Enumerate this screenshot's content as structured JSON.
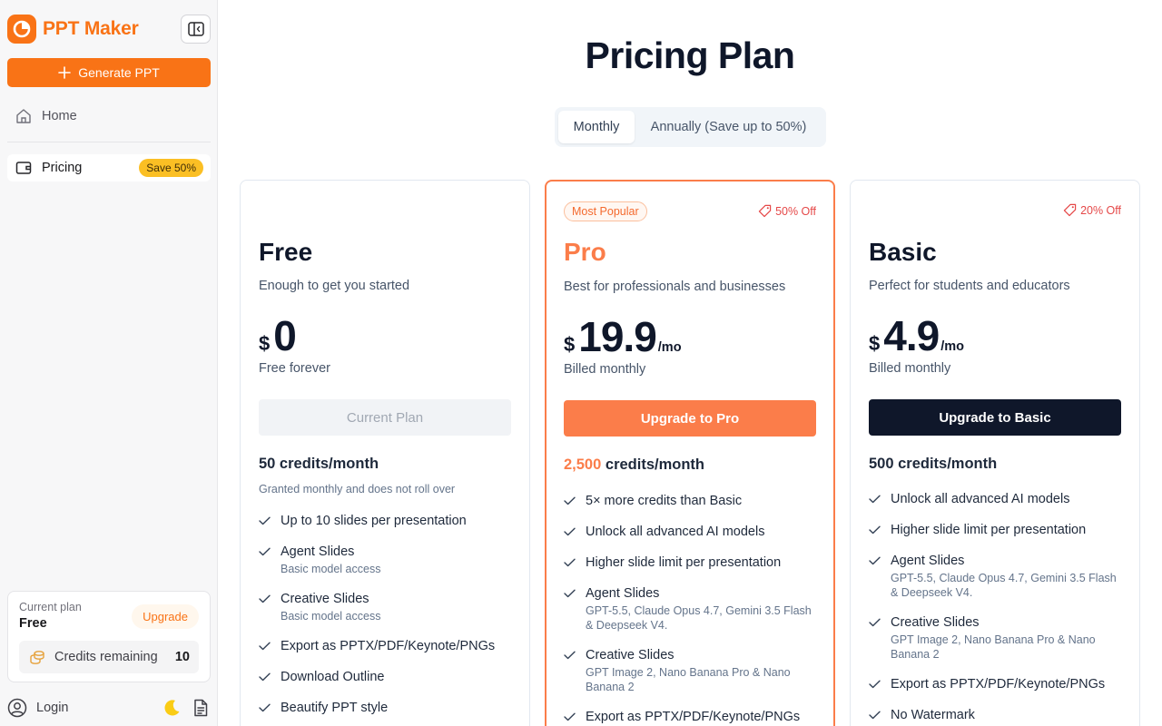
{
  "sidebar": {
    "brand": "PPT Maker",
    "generate_label": "Generate PPT",
    "home_label": "Home",
    "pricing_label": "Pricing",
    "pricing_badge": "Save 50%",
    "current_plan_label": "Current plan",
    "current_plan_name": "Free",
    "upgrade_label": "Upgrade",
    "credits_label": "Credits remaining",
    "credits_count": "10",
    "login_label": "Login"
  },
  "main": {
    "title": "Pricing Plan",
    "billing_toggle": {
      "monthly": "Monthly",
      "annually": "Annually (Save up to 50%)",
      "selected": "Monthly"
    }
  },
  "plans": {
    "free": {
      "name": "Free",
      "description": "Enough to get you started",
      "currency": "$",
      "price": "0",
      "billing": "Free forever",
      "cta": "Current Plan",
      "credits": "50 credits/month",
      "credits_note": "Granted monthly and does not roll over",
      "features": [
        {
          "text": "Up to 10 slides per presentation",
          "sub": ""
        },
        {
          "text": "Agent Slides",
          "sub": "Basic model access"
        },
        {
          "text": "Creative Slides",
          "sub": "Basic model access"
        },
        {
          "text": "Export as PPTX/PDF/Keynote/PNGs",
          "sub": ""
        },
        {
          "text": "Download Outline",
          "sub": ""
        },
        {
          "text": "Beautify PPT style",
          "sub": ""
        }
      ]
    },
    "pro": {
      "badge": "Most Popular",
      "discount": "50% Off",
      "name": "Pro",
      "description": "Best for professionals and businesses",
      "currency": "$",
      "price": "19.9",
      "per": "/mo",
      "billing": "Billed monthly",
      "cta": "Upgrade to Pro",
      "credits_amount": "2,500",
      "credits_suffix": "credits/month",
      "features": [
        {
          "text": "5× more credits than Basic",
          "sub": ""
        },
        {
          "text": "Unlock all advanced AI models",
          "sub": ""
        },
        {
          "text": "Higher slide limit per presentation",
          "sub": ""
        },
        {
          "text": "Agent Slides",
          "sub": "GPT-5.5, Claude Opus 4.7, Gemini 3.5 Flash & Deepseek V4."
        },
        {
          "text": "Creative Slides",
          "sub": "GPT Image 2, Nano Banana Pro & Nano Banana 2"
        },
        {
          "text": "Export as PPTX/PDF/Keynote/PNGs",
          "sub": ""
        }
      ]
    },
    "basic": {
      "discount": "20% Off",
      "name": "Basic",
      "description": "Perfect for students and educators",
      "currency": "$",
      "price": "4.9",
      "per": "/mo",
      "billing": "Billed monthly",
      "cta": "Upgrade to Basic",
      "credits": "500 credits/month",
      "features": [
        {
          "text": "Unlock all advanced AI models",
          "sub": ""
        },
        {
          "text": "Higher slide limit per presentation",
          "sub": ""
        },
        {
          "text": "Agent Slides",
          "sub": "GPT-5.5, Claude Opus 4.7, Gemini 3.5 Flash & Deepseek V4."
        },
        {
          "text": "Creative Slides",
          "sub": "GPT Image 2, Nano Banana Pro & Nano Banana 2"
        },
        {
          "text": "Export as PPTX/PDF/Keynote/PNGs",
          "sub": ""
        },
        {
          "text": "No Watermark",
          "sub": ""
        }
      ]
    }
  },
  "colors": {
    "brand": "#f97316",
    "pro_accent": "#fb7d4a",
    "dark_button": "#0f172a",
    "discount": "#e54848"
  }
}
